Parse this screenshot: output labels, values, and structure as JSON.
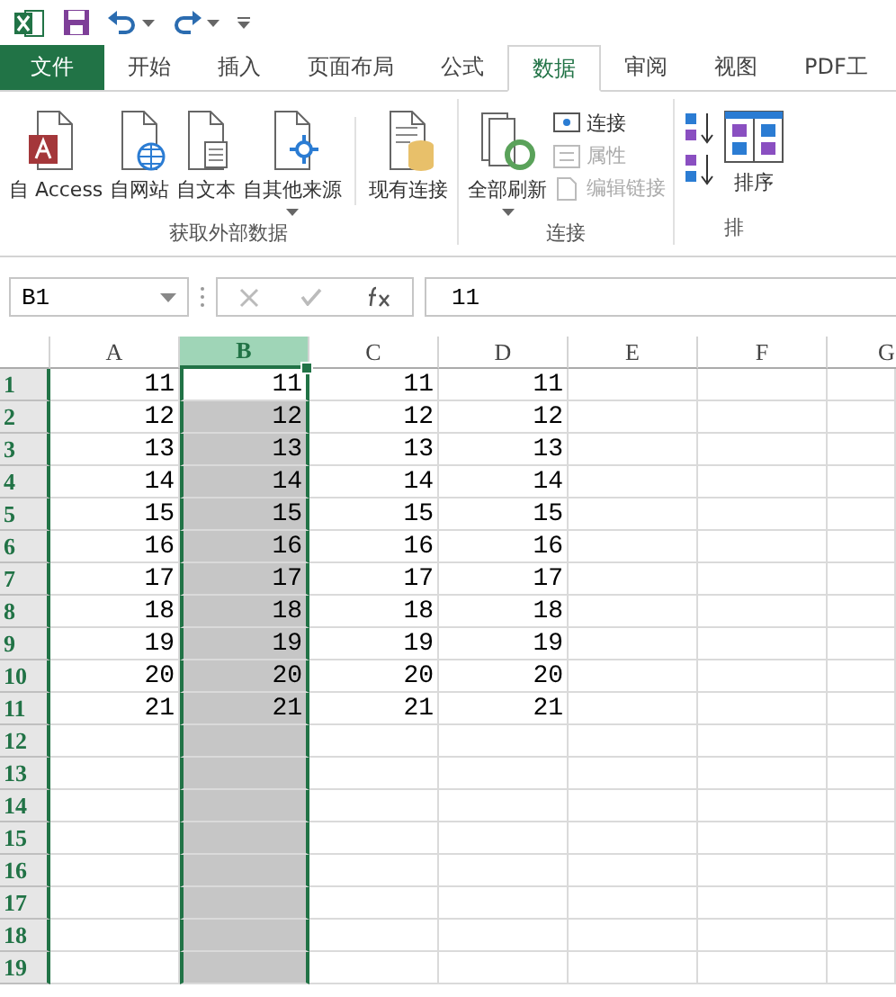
{
  "tabs": [
    {
      "label": "文件",
      "kind": "file",
      "selected": false
    },
    {
      "label": "开始",
      "kind": "tab",
      "selected": false
    },
    {
      "label": "插入",
      "kind": "tab",
      "selected": false
    },
    {
      "label": "页面布局",
      "kind": "tab",
      "selected": false
    },
    {
      "label": "公式",
      "kind": "tab",
      "selected": false
    },
    {
      "label": "数据",
      "kind": "tab",
      "selected": true
    },
    {
      "label": "审阅",
      "kind": "tab",
      "selected": false
    },
    {
      "label": "视图",
      "kind": "tab",
      "selected": false
    },
    {
      "label": "PDF工",
      "kind": "tab",
      "selected": false
    }
  ],
  "ribbon_groups": [
    {
      "label": "获取外部数据",
      "buttons": [
        {
          "kind": "large",
          "label": "自 Access",
          "dropdown": false
        },
        {
          "kind": "large",
          "label": "自网站",
          "dropdown": false
        },
        {
          "kind": "large",
          "label": "自文本",
          "dropdown": false
        },
        {
          "kind": "large",
          "label": "自其他来源",
          "dropdown": true
        },
        {
          "kind": "separator"
        },
        {
          "kind": "large",
          "label": "现有连接",
          "dropdown": false
        }
      ]
    },
    {
      "label": "连接",
      "buttons": [
        {
          "kind": "large",
          "label": "全部刷新",
          "dropdown": true
        },
        {
          "kind": "small",
          "label": "连接",
          "disabled": false
        },
        {
          "kind": "small",
          "label": "属性",
          "disabled": true
        },
        {
          "kind": "small",
          "label": "编辑链接",
          "disabled": true
        }
      ]
    },
    {
      "label": "排",
      "buttons": [
        {
          "kind": "icon"
        },
        {
          "kind": "icon"
        },
        {
          "kind": "large",
          "label": "排序",
          "dropdown": false
        }
      ]
    }
  ],
  "name_box": "B1",
  "formula": "11",
  "columns": [
    {
      "label": "A",
      "selected": false
    },
    {
      "label": "B",
      "selected": true
    },
    {
      "label": "C",
      "selected": false
    },
    {
      "label": "D",
      "selected": false
    },
    {
      "label": "E",
      "selected": false
    },
    {
      "label": "F",
      "selected": false
    },
    {
      "label": "G",
      "selected": false
    }
  ],
  "rows": [
    {
      "label": "1",
      "active": true,
      "cells": [
        "11",
        "11",
        "11",
        "11"
      ]
    },
    {
      "label": "2",
      "active": false,
      "cells": [
        "12",
        "12",
        "12",
        "12"
      ]
    },
    {
      "label": "3",
      "active": false,
      "cells": [
        "13",
        "13",
        "13",
        "13"
      ]
    },
    {
      "label": "4",
      "active": false,
      "cells": [
        "14",
        "14",
        "14",
        "14"
      ]
    },
    {
      "label": "5",
      "active": false,
      "cells": [
        "15",
        "15",
        "15",
        "15"
      ]
    },
    {
      "label": "6",
      "active": false,
      "cells": [
        "16",
        "16",
        "16",
        "16"
      ]
    },
    {
      "label": "7",
      "active": false,
      "cells": [
        "17",
        "17",
        "17",
        "17"
      ]
    },
    {
      "label": "8",
      "active": false,
      "cells": [
        "18",
        "18",
        "18",
        "18"
      ]
    },
    {
      "label": "9",
      "active": false,
      "cells": [
        "19",
        "19",
        "19",
        "19"
      ]
    },
    {
      "label": "10",
      "active": false,
      "cells": [
        "20",
        "20",
        "20",
        "20"
      ]
    },
    {
      "label": "11",
      "active": false,
      "cells": [
        "21",
        "21",
        "21",
        "21"
      ]
    },
    {
      "label": "12",
      "active": false
    },
    {
      "label": "13",
      "active": false
    },
    {
      "label": "14",
      "active": false
    },
    {
      "label": "15",
      "active": false
    },
    {
      "label": "16",
      "active": false
    },
    {
      "label": "17",
      "active": false
    },
    {
      "label": "18",
      "active": false
    },
    {
      "label": "19",
      "active": false
    }
  ]
}
